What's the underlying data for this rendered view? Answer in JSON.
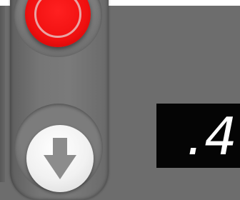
{
  "controls": {
    "stop_button": {
      "icon": "stop-icon",
      "color": "#ff1a1a",
      "ring_color": "#e9a3a3"
    },
    "down_button": {
      "icon": "down-arrow-icon",
      "color": "#f2f2f2",
      "icon_color": "#8c8c8c"
    }
  },
  "display": {
    "value": ".4",
    "background": "#050505",
    "text_color": "#ffffff"
  }
}
